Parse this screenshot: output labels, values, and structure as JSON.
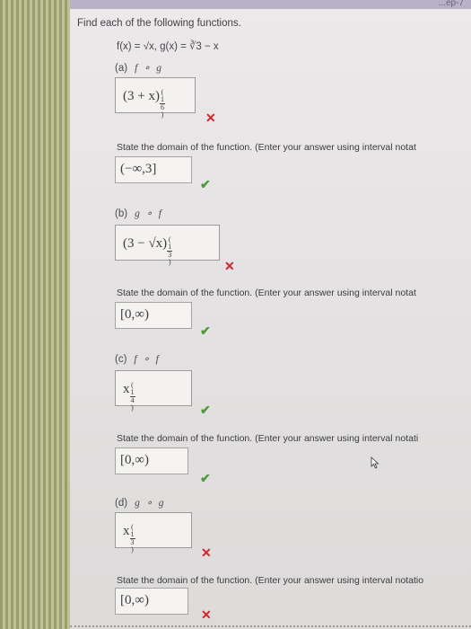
{
  "question": "Find each of the following functions.",
  "functions_line": "f(x) = √x, g(x) = ∛3 − x",
  "parts": [
    {
      "label": "(a)",
      "comp": "f ∘ g",
      "answer": "(3 + x)",
      "exponent_num": "1",
      "exponent_den": "6",
      "answer_status": "incorrect",
      "domain_prompt": "State the domain of the function. (Enter your answer using interval notat",
      "domain": "(−∞,3]",
      "domain_status": "correct"
    },
    {
      "label": "(b)",
      "comp": "g ∘ f",
      "answer": "(3 − √x)",
      "exponent_num": "1",
      "exponent_den": "3",
      "answer_status": "incorrect",
      "domain_prompt": "State the domain of the function. (Enter your answer using interval notat",
      "domain": "[0,∞)",
      "domain_status": "correct"
    },
    {
      "label": "(c)",
      "comp": "f ∘ f",
      "answer": "x",
      "exponent_num": "1",
      "exponent_den": "4",
      "answer_status": "correct",
      "domain_prompt": "State the domain of the function. (Enter your answer using interval notati",
      "domain": "[0,∞)",
      "domain_status": "correct"
    },
    {
      "label": "(d)",
      "comp": "g ∘ g",
      "answer": "x",
      "exponent_num": "1",
      "exponent_den": "3",
      "answer_status": "incorrect",
      "domain_prompt": "State the domain of the function. (Enter your answer using interval notatio",
      "domain": "[0,∞)",
      "domain_status": "incorrect"
    }
  ],
  "icons": {
    "correct": "check-icon",
    "incorrect": "x-icon"
  },
  "colors": {
    "correct": "#4e9b3b",
    "incorrect": "#d0252b"
  },
  "top_strip_text": "...ep-7"
}
